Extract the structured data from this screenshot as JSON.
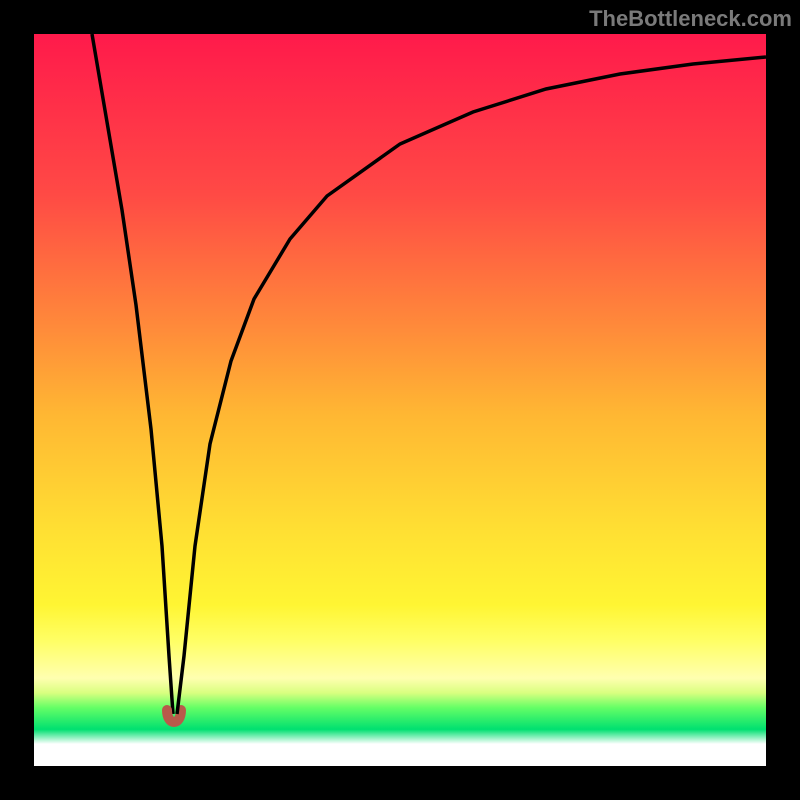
{
  "watermark": "TheBottleneck.com",
  "chart_data": {
    "type": "line",
    "title": "",
    "xlabel": "",
    "ylabel": "",
    "xlim": [
      0,
      100
    ],
    "ylim": [
      0,
      100
    ],
    "note": "No numeric axis labels are present in the image; values are estimated from pixel positions on a 0–100 normalized scale. Curve has a sharp minimum near x≈19, y≈7, with a small flat-bottom notch (rendered as a brown marker).",
    "series": [
      {
        "name": "bottleneck-curve",
        "x": [
          8,
          10,
          12,
          14,
          16,
          17.5,
          18.5,
          19,
          19.5,
          20.5,
          22,
          24,
          27,
          30,
          35,
          40,
          50,
          60,
          70,
          80,
          90,
          100
        ],
        "y": [
          100,
          88,
          76,
          63,
          46,
          30,
          15,
          7,
          15,
          30,
          44,
          55,
          65,
          71,
          78,
          82,
          87.5,
          90.5,
          92.5,
          93.8,
          94.7,
          95.3
        ]
      }
    ],
    "marker": {
      "name": "minimum-notch",
      "x": 19,
      "y": 7,
      "color": "#b85a4a"
    },
    "background_gradient": {
      "direction": "top-to-bottom",
      "stops": [
        {
          "pos": 0,
          "color": "#ff1a4b"
        },
        {
          "pos": 50,
          "color": "#ffb733"
        },
        {
          "pos": 80,
          "color": "#ffff66"
        },
        {
          "pos": 92,
          "color": "#00e070"
        },
        {
          "pos": 100,
          "color": "#ffffff"
        }
      ]
    }
  }
}
